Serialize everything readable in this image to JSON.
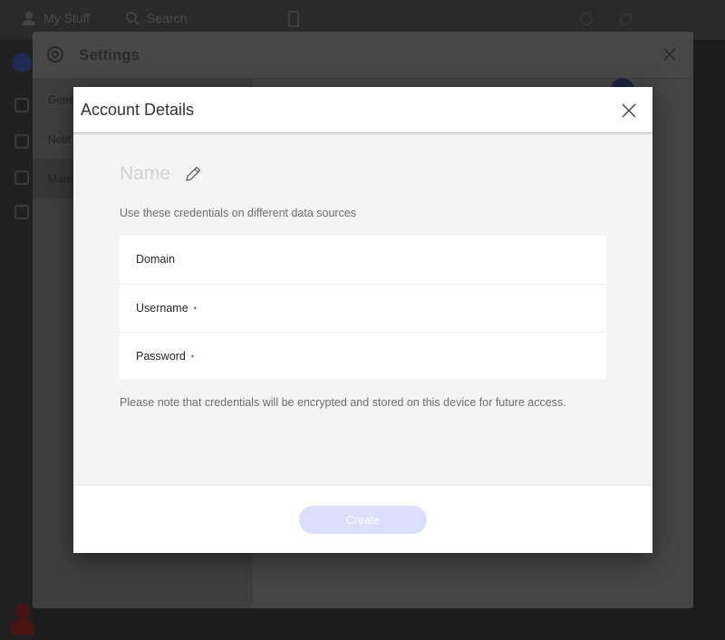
{
  "background": {
    "topbar": {
      "user_label": "My Stuff",
      "search_label": "Search"
    },
    "settings": {
      "title": "Settings",
      "nav": [
        "Gene",
        "Notif",
        "Mana"
      ]
    }
  },
  "modal": {
    "title": "Account Details",
    "name_placeholder": "Name",
    "description": "Use these credentials on different data sources",
    "fields": [
      {
        "label": "Domain",
        "required": false
      },
      {
        "label": "Username",
        "required": true
      },
      {
        "label": "Password",
        "required": true
      }
    ],
    "required_marker": "•",
    "note": "Please note that credentials will be encrypted and stored on this device for future access.",
    "create_label": "Create"
  },
  "colors": {
    "accent_disabled": "#dcdffc",
    "required": "#c02a5c"
  },
  "icons": [
    "close-icon",
    "edit-icon",
    "settings-icon",
    "user-icon",
    "search-icon",
    "trash-icon",
    "plus-icon"
  ]
}
